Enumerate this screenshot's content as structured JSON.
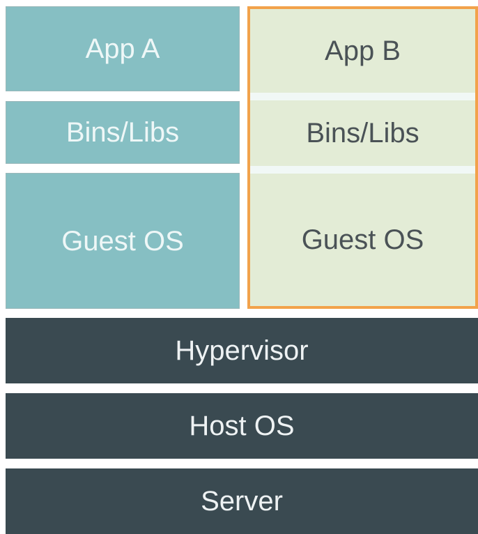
{
  "vm_a": {
    "app": "App A",
    "bins": "Bins/Libs",
    "guest_os": "Guest OS"
  },
  "vm_b": {
    "app": "App B",
    "bins": "Bins/Libs",
    "guest_os": "Guest OS",
    "highlight_color": "#f2a24b"
  },
  "stack": {
    "hypervisor": "Hypervisor",
    "host_os": "Host OS",
    "server": "Server"
  },
  "colors": {
    "vm_a_fill": "#86bfc3",
    "vm_b_fill": "#e6ecd7",
    "infrastructure_fill": "#3a4a51"
  }
}
